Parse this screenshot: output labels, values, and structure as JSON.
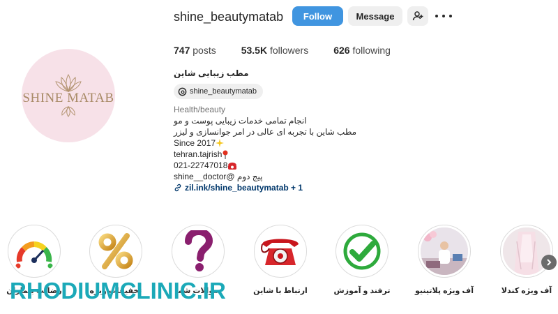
{
  "profile": {
    "username": "shine_beautymatab",
    "avatar_text": "SHINE MATAB",
    "follow_label": "Follow",
    "message_label": "Message"
  },
  "stats": {
    "posts_count": "747",
    "posts_label": "posts",
    "followers_count": "53.5K",
    "followers_label": "followers",
    "following_count": "626",
    "following_label": "following"
  },
  "bio": {
    "name": "مطب زیبایی شاین",
    "threads_handle": "shine_beautymatab",
    "category": "Health/beauty",
    "lines": [
      "انجام تمامی خدمات زیبایی پوست و مو",
      "مطب شاین با تجربه ای عالی در امر جوانسازی و لیزر",
      "Since 2017",
      "tehran.tajrish",
      "021-22747018",
      "پیج دوم @shine__doctor"
    ],
    "link_text": "zil.ink/shine_beautymatab + 1"
  },
  "highlights": [
    {
      "label": "رضایت بیماران",
      "icon": "gauge-icon"
    },
    {
      "label": "تخفیفات ویژه",
      "icon": "percent-icon"
    },
    {
      "label": "سوالات شما",
      "icon": "question-mark-icon"
    },
    {
      "label": "ارتباط با شاین",
      "icon": "telephone-icon"
    },
    {
      "label": "ترفند و آموزش",
      "icon": "checkmark-icon"
    },
    {
      "label": "آف ویژه پلاتینیو",
      "icon": "clinic-photo-icon"
    },
    {
      "label": "آف ویژه کندلا",
      "icon": "dress-photo-icon"
    }
  ],
  "watermark": "RHODIUMCLINIC.IR",
  "colors": {
    "follow_button": "#4095e0",
    "link": "#00376b",
    "watermark": "#1ba9b8",
    "avatar_bg": "#f7e1e8"
  }
}
